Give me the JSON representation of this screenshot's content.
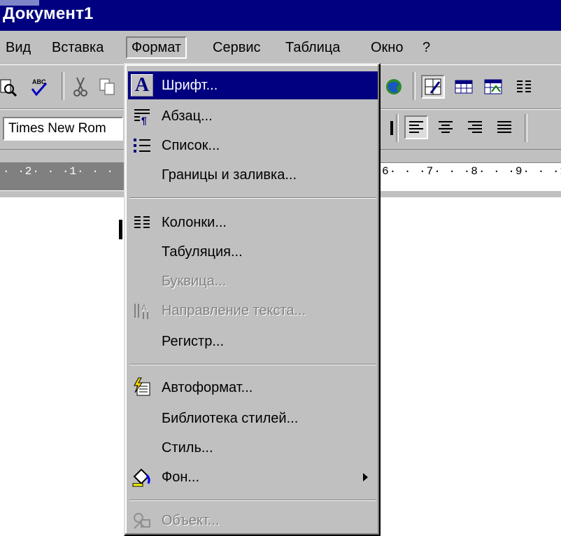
{
  "window": {
    "title": "Документ1"
  },
  "menubar": {
    "items": [
      {
        "label": "Вид"
      },
      {
        "label": "Вставка"
      },
      {
        "label": "Формат"
      },
      {
        "label": "Сервис"
      },
      {
        "label": "Таблица"
      },
      {
        "label": "Окно"
      },
      {
        "label": "?"
      }
    ]
  },
  "toolbar": {
    "font_name": "Times New Rom"
  },
  "ruler": {
    "left_ticks": "· ·2· · ·1· · ·",
    "right_ticks": "6· · ·7· · ·8· · ·9· · ·1"
  },
  "format_menu": {
    "items": [
      {
        "label": "Шрифт...",
        "icon": "font-a-icon",
        "state": "highlighted"
      },
      {
        "label": "Абзац...",
        "icon": "paragraph-icon",
        "state": "enabled"
      },
      {
        "label": "Список...",
        "icon": "bullets-icon",
        "state": "enabled"
      },
      {
        "label": "Границы и заливка...",
        "icon": "",
        "state": "enabled"
      },
      {
        "label": "Колонки...",
        "icon": "columns-icon",
        "state": "enabled"
      },
      {
        "label": "Табуляция...",
        "icon": "",
        "state": "enabled"
      },
      {
        "label": "Буквица...",
        "icon": "",
        "state": "disabled"
      },
      {
        "label": "Направление текста...",
        "icon": "text-direction-icon",
        "state": "disabled"
      },
      {
        "label": "Регистр...",
        "icon": "",
        "state": "enabled"
      },
      {
        "label": "Автоформат...",
        "icon": "autoformat-icon",
        "state": "enabled"
      },
      {
        "label": "Библиотека стилей...",
        "icon": "",
        "state": "enabled"
      },
      {
        "label": "Стиль...",
        "icon": "",
        "state": "enabled"
      },
      {
        "label": "Фон...",
        "icon": "background-fill-icon",
        "state": "enabled",
        "submenu": true
      },
      {
        "label": "Объект...",
        "icon": "object-icon",
        "state": "disabled"
      }
    ]
  },
  "colors": {
    "title_bar": "#000080",
    "menu_face": "#c0c0c0",
    "highlight": "#000080",
    "disabled_text": "#808080"
  }
}
